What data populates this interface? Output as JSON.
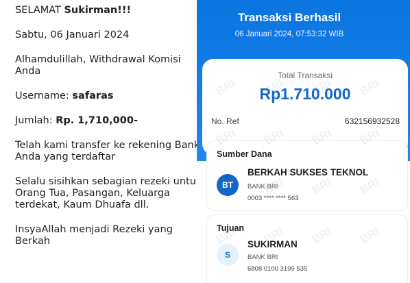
{
  "message": {
    "greeting_prefix": "SELAMAT ",
    "greeting_name": "Sukirman!!!",
    "date": "Sabtu, 06 Januari 2024",
    "line1a": "Alhamdulillah, Withdrawal Komisi",
    "line1b": "Anda",
    "username_label": "Username: ",
    "username_value": "safaras",
    "amount_label": "Jumlah: ",
    "amount_value": "Rp. 1,710,000-",
    "transfer_a": "Telah kami transfer ke rekening Bank",
    "transfer_b": "Anda yang terdaftar",
    "advice_a": "Selalu sisihkan sebagian rezeki untuk",
    "advice_b": "Orang Tua, Pasangan, Keluarga",
    "advice_c": "terdekat, Kaum Dhuafa dll.",
    "closing_a": "InsyaAllah menjadi Rezeki yang",
    "closing_b": "Berkah"
  },
  "receipt": {
    "title": "Transaksi Berhasil",
    "datetime": "06 Januari 2024, 07:53:32 WIB",
    "total_label": "Total Transaksi",
    "total_amount": "Rp1.710.000",
    "ref_label": "No. Ref",
    "ref_value": "632156932528",
    "watermark_text": "BRI",
    "source": {
      "title": "Sumber Dana",
      "initials": "BT",
      "name": "BERKAH SUKSES TEKNOL",
      "bank": "BANK BRI",
      "account": "0003 **** **** 563"
    },
    "destination": {
      "title": "Tujuan",
      "initials": "S",
      "name": "SUKIRMAN",
      "bank": "BANK BRI",
      "account": "6808 0100 3199 535"
    }
  },
  "colors": {
    "header_blue": "#0a74e0",
    "amount_blue": "#1166c9"
  }
}
